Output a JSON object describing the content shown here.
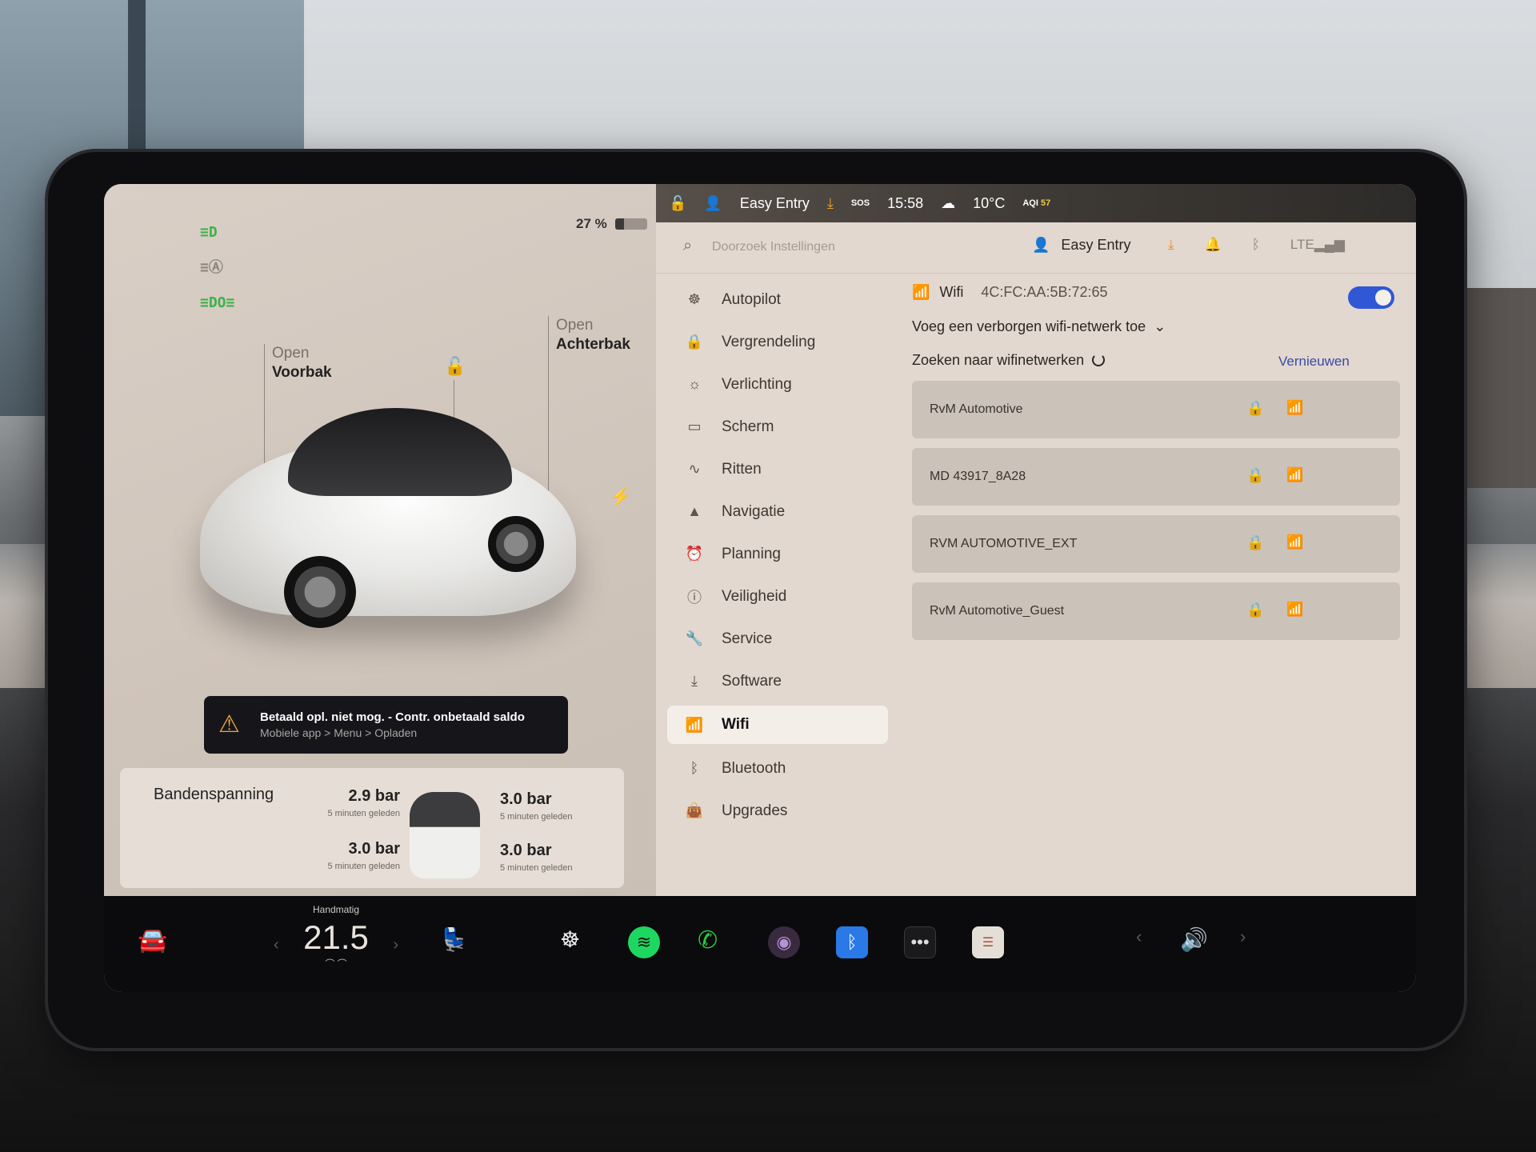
{
  "status_bar": {
    "profile_name": "Easy Entry",
    "sos_label": "SOS",
    "time": "15:58",
    "temperature": "10°C",
    "aqi_label": "AQI",
    "aqi_value": "57"
  },
  "vehicle": {
    "battery_percent_text": "27 %",
    "battery_level": 0.27,
    "front_trunk": {
      "action": "Open",
      "name": "Voorbak"
    },
    "rear_trunk": {
      "action": "Open",
      "name": "Achterbak"
    },
    "light_icons": [
      "headlights-on-icon",
      "auto-high-beam-icon",
      "parking-lights-icon"
    ]
  },
  "alert": {
    "title": "Betaald opl. niet mog. - Contr. onbetaald saldo",
    "subtitle": "Mobiele app > Menu > Opladen"
  },
  "tire_pressure": {
    "title": "Bandenspanning",
    "front_left": {
      "value": "2.9 bar",
      "time": "5 minuten geleden"
    },
    "front_right": {
      "value": "3.0 bar",
      "time": "5 minuten geleden"
    },
    "rear_left": {
      "value": "3.0 bar",
      "time": "5 minuten geleden"
    },
    "rear_right": {
      "value": "3.0 bar",
      "time": "5 minuten geleden"
    }
  },
  "settings": {
    "search_placeholder": "Doorzoek Instellingen",
    "profile_name": "Easy Entry",
    "nav": [
      {
        "label": "Autopilot",
        "icon": "steering-wheel-icon"
      },
      {
        "label": "Vergrendeling",
        "icon": "lock-icon"
      },
      {
        "label": "Verlichting",
        "icon": "light-bulb-icon"
      },
      {
        "label": "Scherm",
        "icon": "display-icon"
      },
      {
        "label": "Ritten",
        "icon": "trips-icon"
      },
      {
        "label": "Navigatie",
        "icon": "navigation-arrow-icon"
      },
      {
        "label": "Planning",
        "icon": "alarm-clock-icon"
      },
      {
        "label": "Veiligheid",
        "icon": "safety-alert-icon"
      },
      {
        "label": "Service",
        "icon": "wrench-icon"
      },
      {
        "label": "Software",
        "icon": "download-icon"
      },
      {
        "label": "Wifi",
        "icon": "wifi-icon",
        "active": true
      },
      {
        "label": "Bluetooth",
        "icon": "bluetooth-icon"
      },
      {
        "label": "Upgrades",
        "icon": "shopping-bag-icon"
      }
    ],
    "wifi": {
      "label": "Wifi",
      "mac_address": "4C:FC:AA:5B:72:65",
      "enabled": true,
      "add_hidden_label": "Voeg een verborgen wifi-netwerk toe",
      "scanning_label": "Zoeken naar wifinetwerken",
      "refresh_label": "Vernieuwen",
      "networks": [
        {
          "ssid": "RvM Automotive",
          "secured": true
        },
        {
          "ssid": "MD 43917_8A28",
          "secured": true
        },
        {
          "ssid": "RVM AUTOMOTIVE_EXT",
          "secured": true
        },
        {
          "ssid": "RvM Automotive_Guest",
          "secured": true
        }
      ]
    }
  },
  "dock": {
    "climate_mode": "Handmatig",
    "climate_temp": "21.5",
    "apps": [
      "car-icon",
      "seat-heater-icon",
      "steering-wheel-heater-icon",
      "spotify-icon",
      "phone-icon",
      "camera-icon",
      "bluetooth-icon",
      "more-apps-icon",
      "notes-icon",
      "volume-icon"
    ]
  }
}
